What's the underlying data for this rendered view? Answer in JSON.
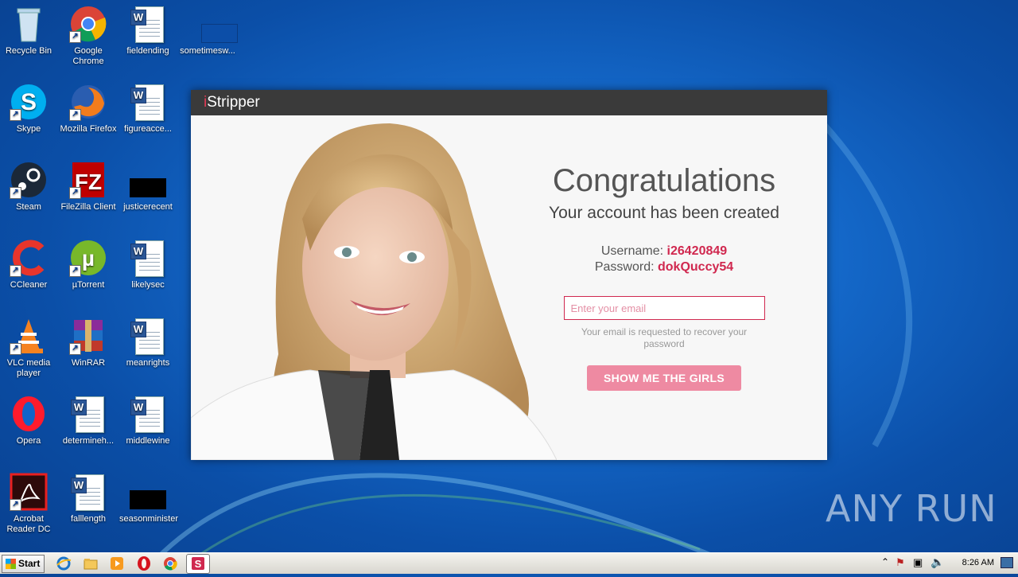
{
  "desktop": {
    "icons": [
      {
        "label": "Recycle Bin"
      },
      {
        "label": "Google Chrome"
      },
      {
        "label": "fieldending"
      },
      {
        "label": "sometimesw..."
      },
      {
        "label": "Skype"
      },
      {
        "label": "Mozilla Firefox"
      },
      {
        "label": "figureacce..."
      },
      {
        "label": "Steam"
      },
      {
        "label": "FileZilla Client"
      },
      {
        "label": "justicerecent"
      },
      {
        "label": "CCleaner"
      },
      {
        "label": "µTorrent"
      },
      {
        "label": "likelysec"
      },
      {
        "label": "VLC media player"
      },
      {
        "label": "WinRAR"
      },
      {
        "label": "meanrights"
      },
      {
        "label": "Opera"
      },
      {
        "label": "determineh..."
      },
      {
        "label": "middlewine"
      },
      {
        "label": "Acrobat Reader DC"
      },
      {
        "label": "falllength"
      },
      {
        "label": "seasonminister"
      }
    ]
  },
  "dialog": {
    "title_i": "i",
    "title_rest": "Stripper",
    "heading": "Congratulations",
    "subheading": "Your account has been created",
    "username_label": "Username:",
    "username_value": "i26420849",
    "password_label": "Password:",
    "password_value": "dokQuccy54",
    "email_placeholder": "Enter your email",
    "email_value": "",
    "email_hint": "Your email is requested to recover your password",
    "cta_label": "SHOW ME THE GIRLS"
  },
  "watermark": "ANY RUN",
  "taskbar": {
    "start_label": "Start",
    "clock": "8:26 AM"
  },
  "colors": {
    "accent": "#d0284f",
    "button": "#ee8aa2",
    "titlebar": "#3a3a3a"
  }
}
